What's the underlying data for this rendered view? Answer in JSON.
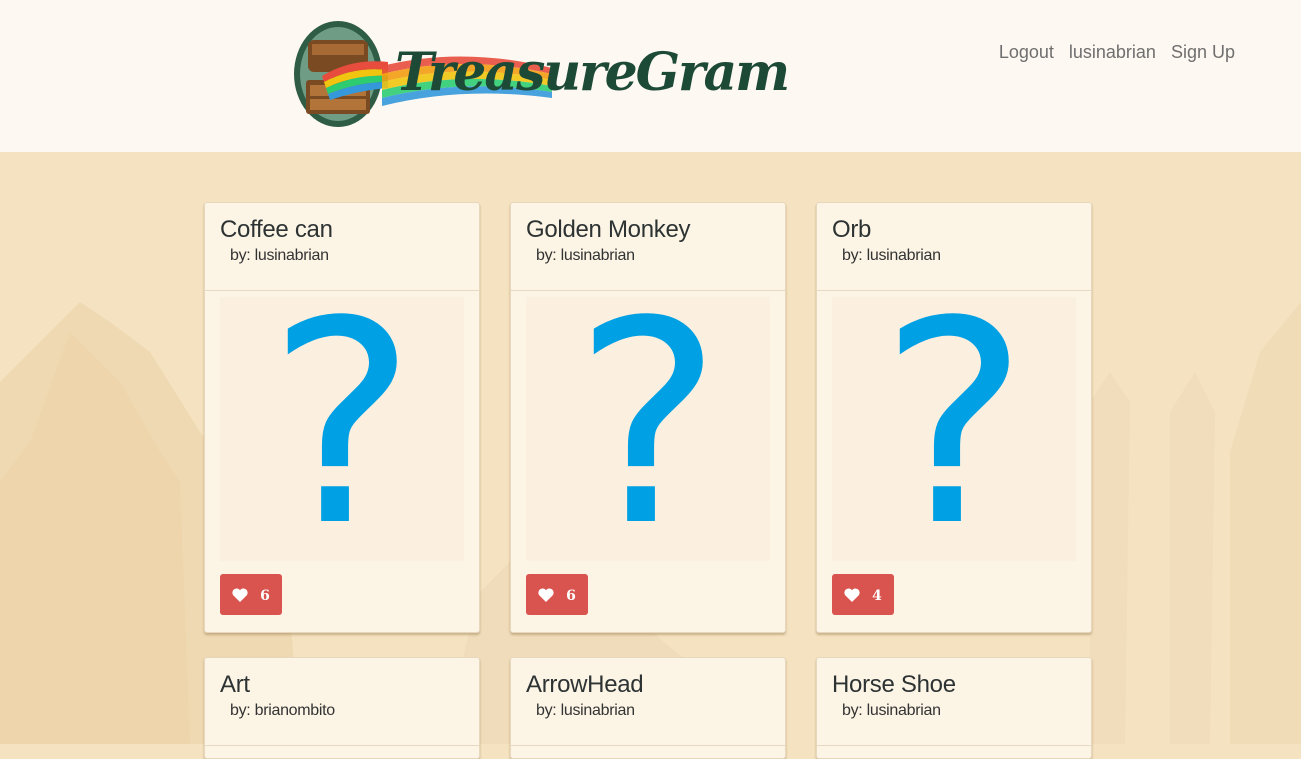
{
  "brand": {
    "name": "TreasureGram"
  },
  "nav": {
    "logout": "Logout",
    "username": "lusinabrian",
    "signup": "Sign Up"
  },
  "colors": {
    "like_button": "#d9534f",
    "question_mark": "#00a0e4",
    "header_bg": "#fdf8f1",
    "page_bg": "#f4e2c0",
    "logo_text": "#1d4a37"
  },
  "cards": [
    {
      "title": "Coffee can",
      "author": "by: lusinabrian",
      "image_icon": "question-mark",
      "likes": "6"
    },
    {
      "title": "Golden Monkey",
      "author": "by: lusinabrian",
      "image_icon": "question-mark",
      "likes": "6"
    },
    {
      "title": "Orb",
      "author": "by: lusinabrian",
      "image_icon": "question-mark",
      "likes": "4"
    },
    {
      "title": "Art",
      "author": "by: brianombito"
    },
    {
      "title": "ArrowHead",
      "author": "by: lusinabrian"
    },
    {
      "title": "Horse Shoe",
      "author": "by: lusinabrian"
    }
  ]
}
